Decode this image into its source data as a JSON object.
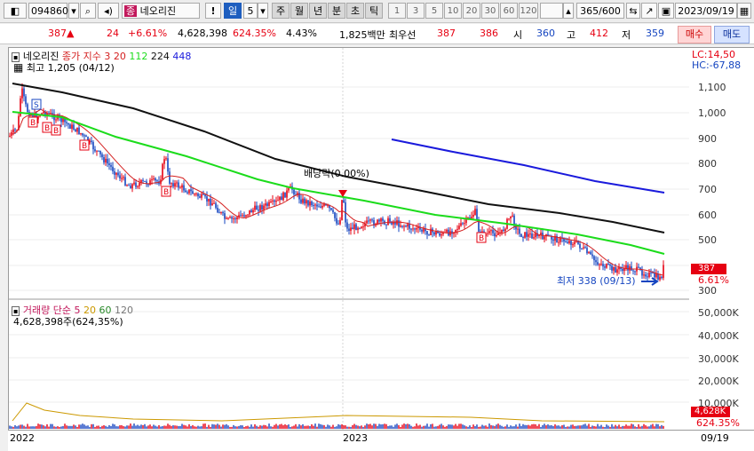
{
  "toolbar": {
    "code": "094860",
    "name_badge": "종",
    "name": "네오리진",
    "period_options": [
      "일",
      "5",
      "주",
      "월",
      "년",
      "분",
      "초",
      "틱"
    ],
    "selected_period": "일",
    "intervals": [
      "1",
      "3",
      "5",
      "10",
      "20",
      "30",
      "60",
      "120"
    ],
    "count": "365/600",
    "date": "2023/09/19"
  },
  "quote": {
    "price": "387",
    "arrow": "▲",
    "change": "24",
    "change_pct": "+6.61%",
    "volume": "4,628,398",
    "volume_ratio": "624.35%",
    "turnover_pct": "4.43%",
    "amount": "1,825백만",
    "best_label": "최우선",
    "best_ask": "387",
    "best_bid": "386",
    "open_label": "시",
    "open": "360",
    "high_label": "고",
    "high": "412",
    "low_label": "저",
    "low": "359",
    "buy_label": "매수",
    "sell_label": "매도"
  },
  "price_panel": {
    "title": "네오리진",
    "legend_label": "종가 지수 3",
    "ma_periods": [
      "20",
      "112",
      "224",
      "448"
    ],
    "high_note": "최고 1,205 (04/12)",
    "low_note": "최저 338 (09/13)",
    "dividend_note": "배당락(0.00%)",
    "lc": "LC:14,50",
    "hc": "HC:-67,88",
    "y_ticks": [
      "1,100",
      "1,000",
      "900",
      "800",
      "700",
      "600",
      "500",
      "300"
    ],
    "current_tag": "387",
    "current_pct": "6.61%"
  },
  "volume_panel": {
    "legend_label": "거래량 단순 5",
    "ma_periods": [
      "20",
      "60",
      "120"
    ],
    "current_note": "4,628,398주(624,35%)",
    "y_ticks": [
      "50,000K",
      "40,000K",
      "30,000K",
      "20,000K",
      "10,000K"
    ],
    "current_tag": "4,628K",
    "current_pct": "624.35%"
  },
  "time_axis": {
    "labels": [
      "2022",
      "2023"
    ],
    "right_label": "09/19"
  },
  "colors": {
    "up": "#e60012",
    "down": "#1545c0",
    "ma20": "#d42020",
    "ma112": "#1bdc1b",
    "ma224": "#111111",
    "ma448": "#1a1adc"
  }
}
